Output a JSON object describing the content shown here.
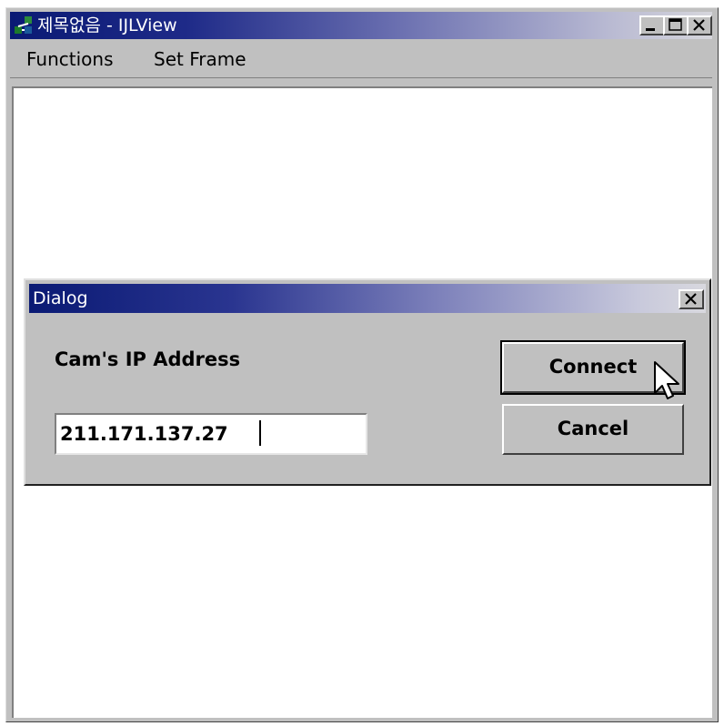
{
  "window": {
    "title": "제목없음 - IJLView",
    "icon": "app-network-icon"
  },
  "menu": {
    "items": [
      "Functions",
      "Set Frame"
    ]
  },
  "dialog": {
    "title": "Dialog",
    "ip_label": "Cam's IP Address",
    "ip_value": "211.171.137.27",
    "connect_label": "Connect",
    "cancel_label": "Cancel"
  }
}
